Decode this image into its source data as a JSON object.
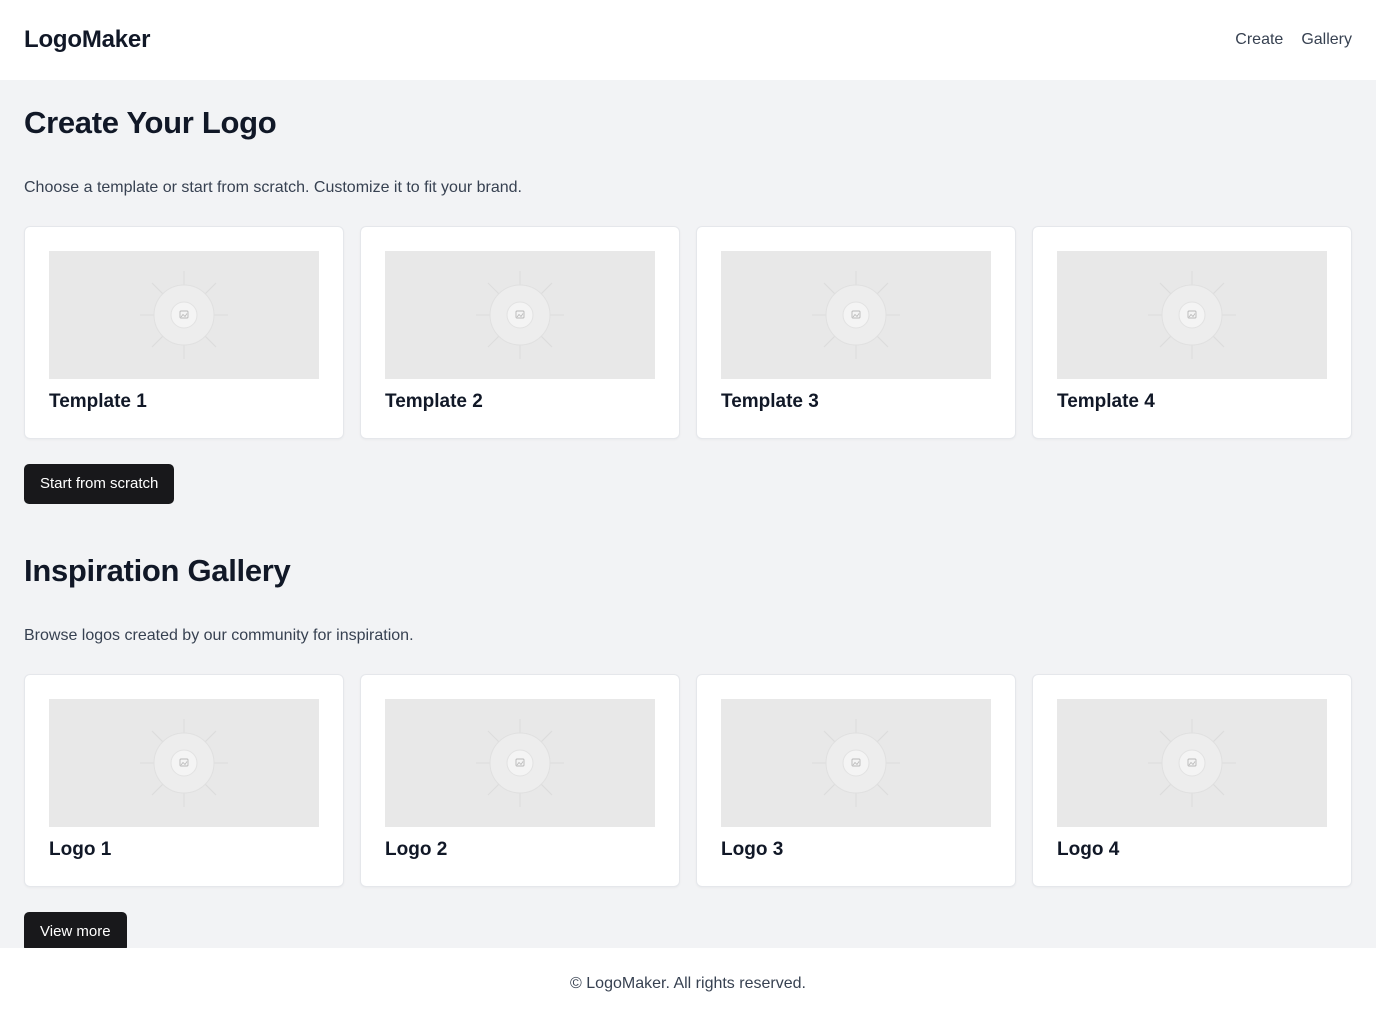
{
  "header": {
    "brand": "LogoMaker",
    "nav": [
      {
        "label": "Create"
      },
      {
        "label": "Gallery"
      }
    ]
  },
  "create": {
    "title": "Create Your Logo",
    "description": "Choose a template or start from scratch. Customize it to fit your brand.",
    "templates": [
      {
        "title": "Template 1",
        "image_icon": "image-placeholder-icon"
      },
      {
        "title": "Template 2",
        "image_icon": "image-placeholder-icon"
      },
      {
        "title": "Template 3",
        "image_icon": "image-placeholder-icon"
      },
      {
        "title": "Template 4",
        "image_icon": "image-placeholder-icon"
      }
    ],
    "button_label": "Start from scratch"
  },
  "gallery": {
    "title": "Inspiration Gallery",
    "description": "Browse logos created by our community for inspiration.",
    "logos": [
      {
        "title": "Logo 1",
        "image_icon": "image-placeholder-icon"
      },
      {
        "title": "Logo 2",
        "image_icon": "image-placeholder-icon"
      },
      {
        "title": "Logo 3",
        "image_icon": "image-placeholder-icon"
      },
      {
        "title": "Logo 4",
        "image_icon": "image-placeholder-icon"
      }
    ],
    "button_label": "View more"
  },
  "footer": {
    "text": "© LogoMaker. All rights reserved."
  },
  "colors": {
    "page_bg": "#f2f3f5",
    "surface": "#ffffff",
    "button_bg": "#18181b",
    "placeholder_bg": "#e8e8e8"
  }
}
